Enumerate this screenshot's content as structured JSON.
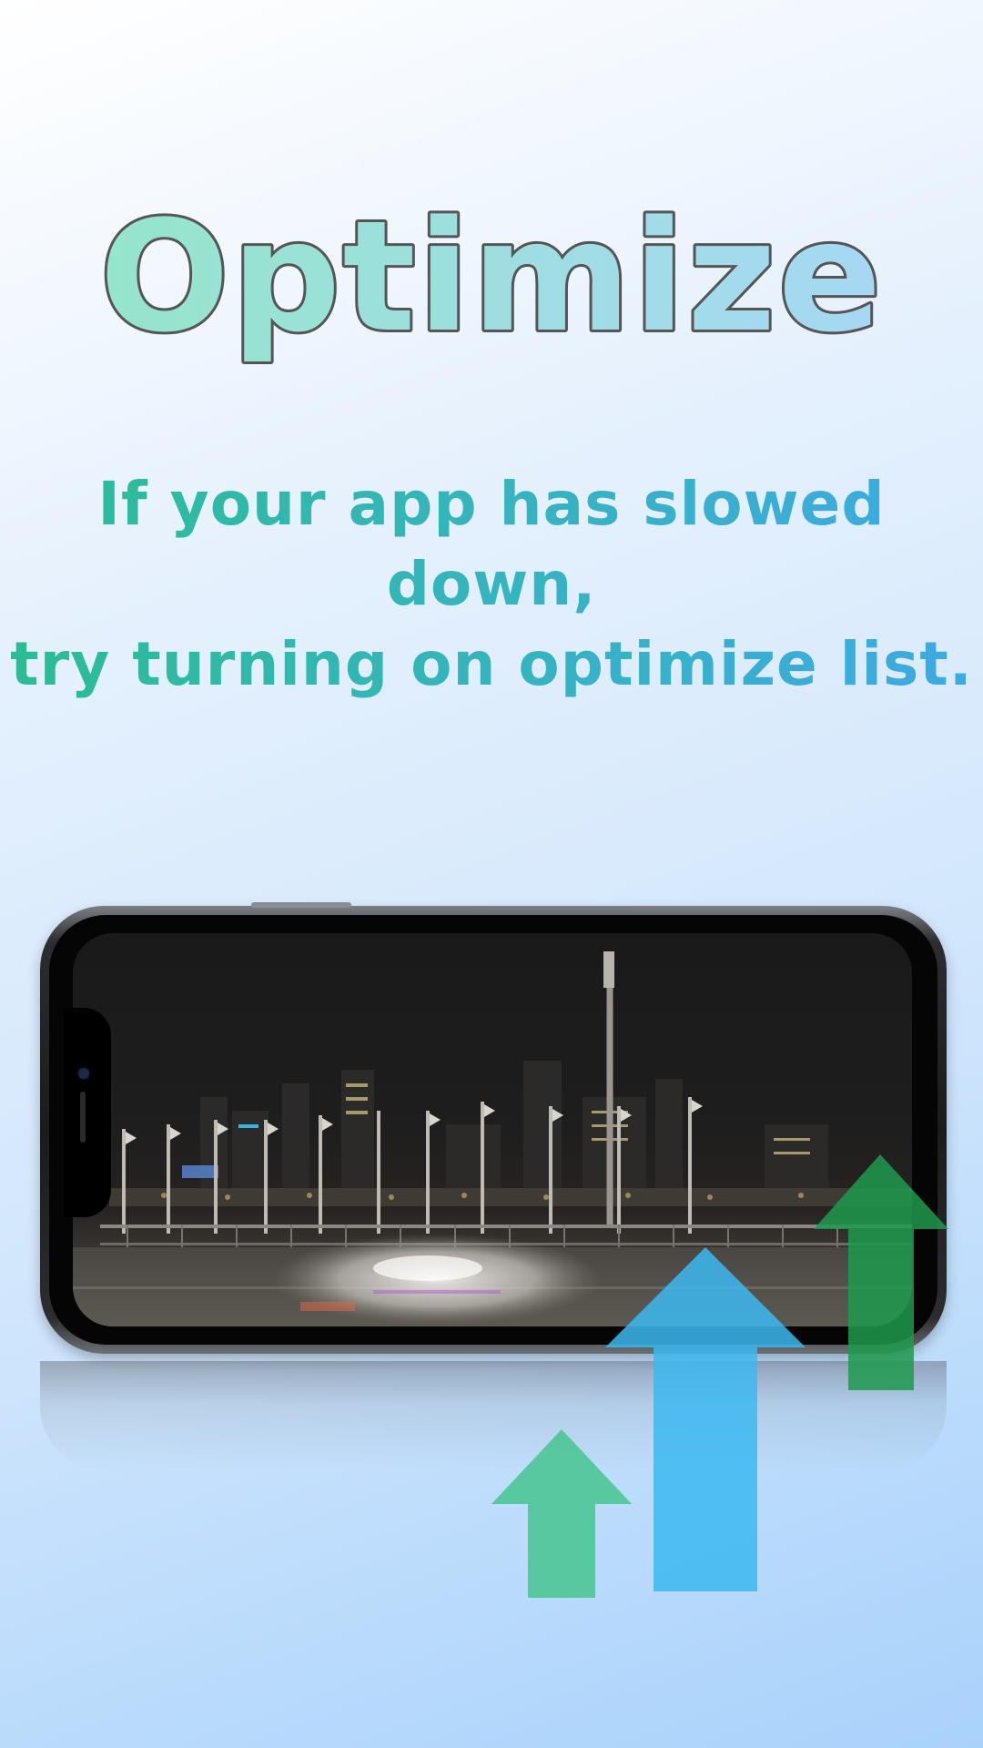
{
  "title": "Optimize",
  "subtitle": {
    "line1": "If your app has slowed down,",
    "line2": "try turning on optimize list."
  },
  "colors": {
    "title_gradient_start": "#95e5cb",
    "title_gradient_end": "#a6d8f4",
    "title_outline": "#555555",
    "subtitle_start": "#2bbd93",
    "subtitle_end": "#3ea9e3",
    "arrow_green_light": "#4cc596",
    "arrow_blue": "#3cb8f0",
    "arrow_green_dark": "#1f9a4e"
  },
  "icons": {
    "phone": "phone-landscape-icon",
    "arrows": [
      "arrow-up-small-icon",
      "arrow-up-large-icon",
      "arrow-up-dark-icon"
    ]
  }
}
